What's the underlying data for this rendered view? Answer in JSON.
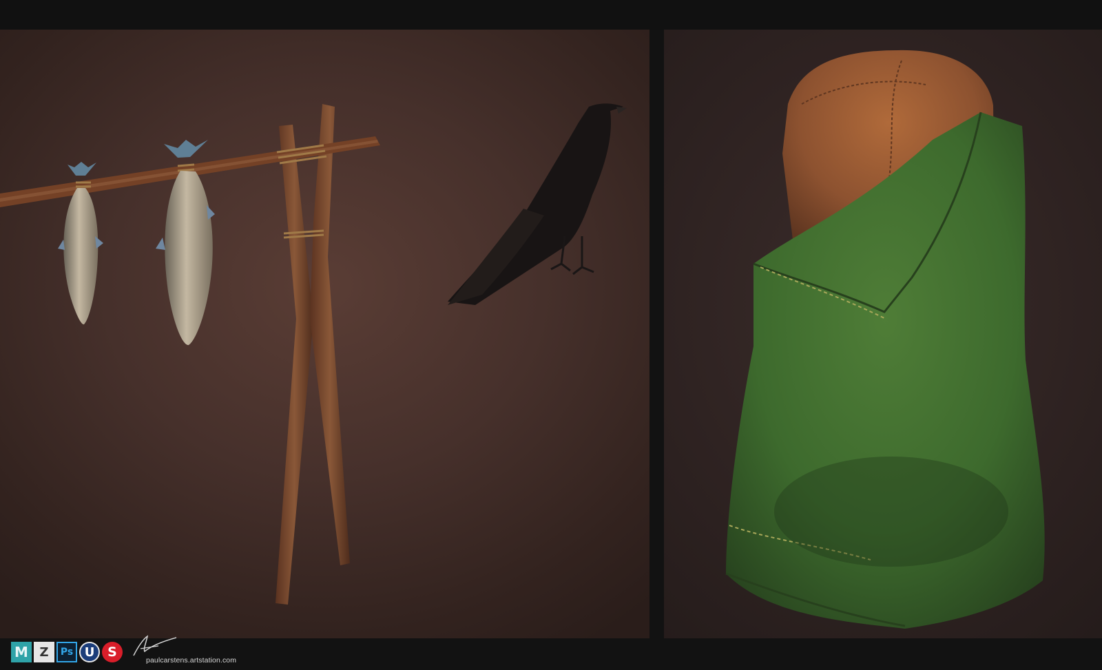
{
  "credit": {
    "website": "paulcarstens.artstation.com",
    "software_logos": [
      {
        "name": "maya-logo",
        "glyph": "M"
      },
      {
        "name": "zbrush-logo",
        "glyph": "Z"
      },
      {
        "name": "photoshop-logo",
        "glyph": "Ps"
      },
      {
        "name": "unreal-engine-logo",
        "glyph": "U"
      },
      {
        "name": "substance-painter-logo",
        "glyph": "S"
      }
    ]
  },
  "colors": {
    "frame": "#121212",
    "left_backdrop": "#4a332d",
    "right_backdrop": "#2f2322",
    "wood": "#7a4a30",
    "leather": "#9a5a33",
    "blanket": "#3f6a2e",
    "raven": "#181414",
    "fish": "#a89a88"
  }
}
